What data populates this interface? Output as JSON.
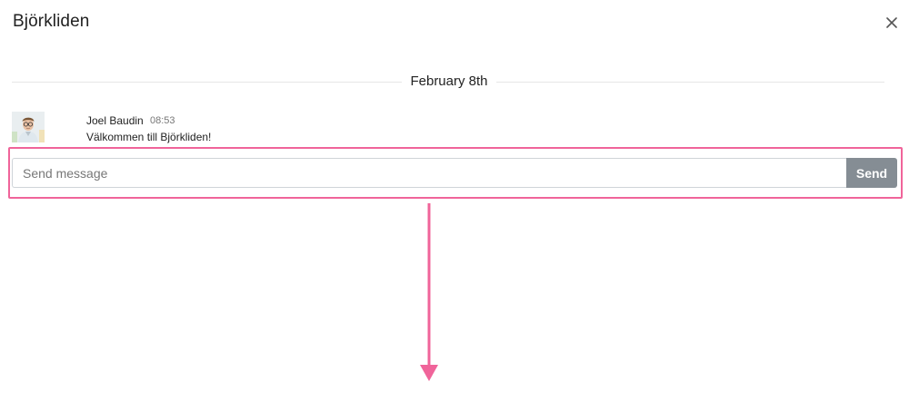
{
  "header": {
    "title": "Björkliden",
    "close_icon": "close-icon"
  },
  "conversation": {
    "date_divider": "February 8th",
    "messages": [
      {
        "author": "Joel Baudin",
        "time": "08:53",
        "text": "Välkommen till Björkliden!",
        "avatar_icon": "user-avatar"
      }
    ]
  },
  "compose": {
    "placeholder": "Send message",
    "value": "",
    "send_label": "Send"
  },
  "colors": {
    "highlight": "#f0649a",
    "send_button": "#858d94",
    "divider": "#e6e6e6"
  }
}
